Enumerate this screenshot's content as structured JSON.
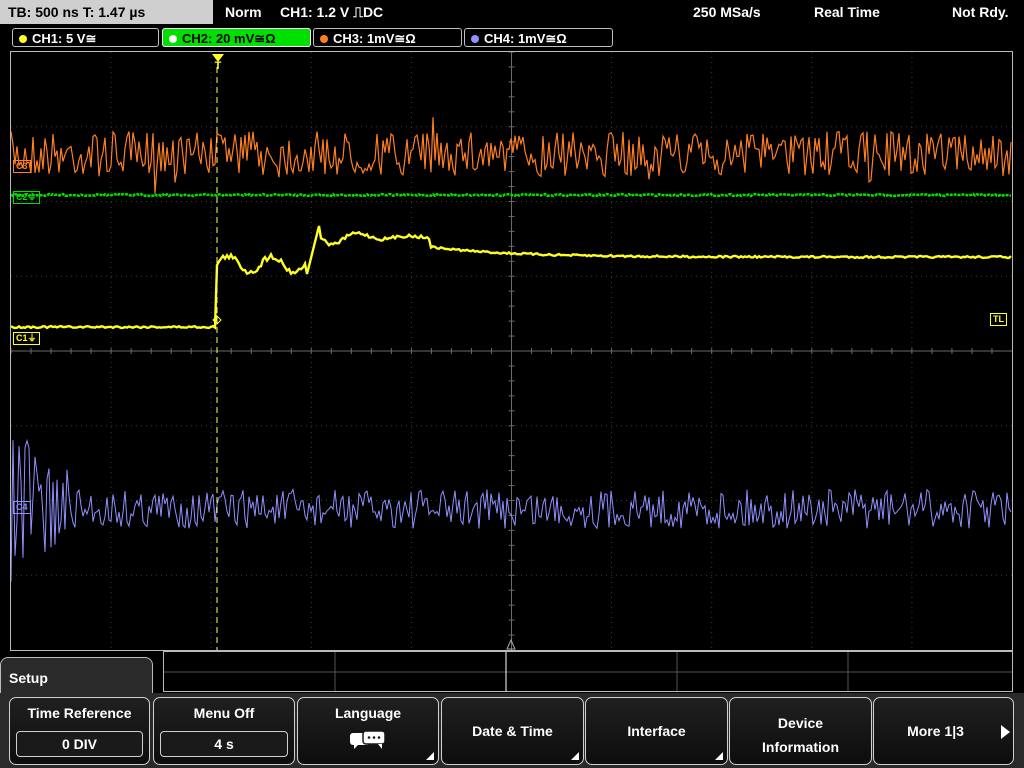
{
  "status": {
    "timebase": "TB: 500 ns   T: 1.47 µs",
    "mode": "Norm",
    "trigger": "CH1: 1.2 V ⎍DC",
    "sample_rate": "250 MSa/s",
    "acq_mode": "Real Time",
    "state": "Not Rdy."
  },
  "channels": [
    {
      "label": "CH1: 5 V≅",
      "color": "#ffff20",
      "active": false
    },
    {
      "label": "CH2: 20 mV≅Ω",
      "color": "#00e000",
      "active": true
    },
    {
      "label": "CH3: 1mV≅Ω",
      "color": "#ff7f20",
      "active": false
    },
    {
      "label": "CH4: 1mV≅Ω",
      "color": "#9090ff",
      "active": false
    }
  ],
  "markers": {
    "c1": "C1⏚",
    "c2": "C2⏚",
    "c3": "C3",
    "c4": "C4",
    "trigger_level": "TL",
    "trigger_pos": "T"
  },
  "menu": {
    "title": "Setup",
    "softkeys": [
      {
        "label": "Time Reference",
        "value": "0 DIV"
      },
      {
        "label": "Menu Off",
        "value": "4 s"
      },
      {
        "label": "Language",
        "icon": "speech-bubbles-icon"
      },
      {
        "label": "Date & Time"
      },
      {
        "label": "Interface"
      },
      {
        "label": "Device Information"
      },
      {
        "label": "More 1|3"
      }
    ]
  }
}
